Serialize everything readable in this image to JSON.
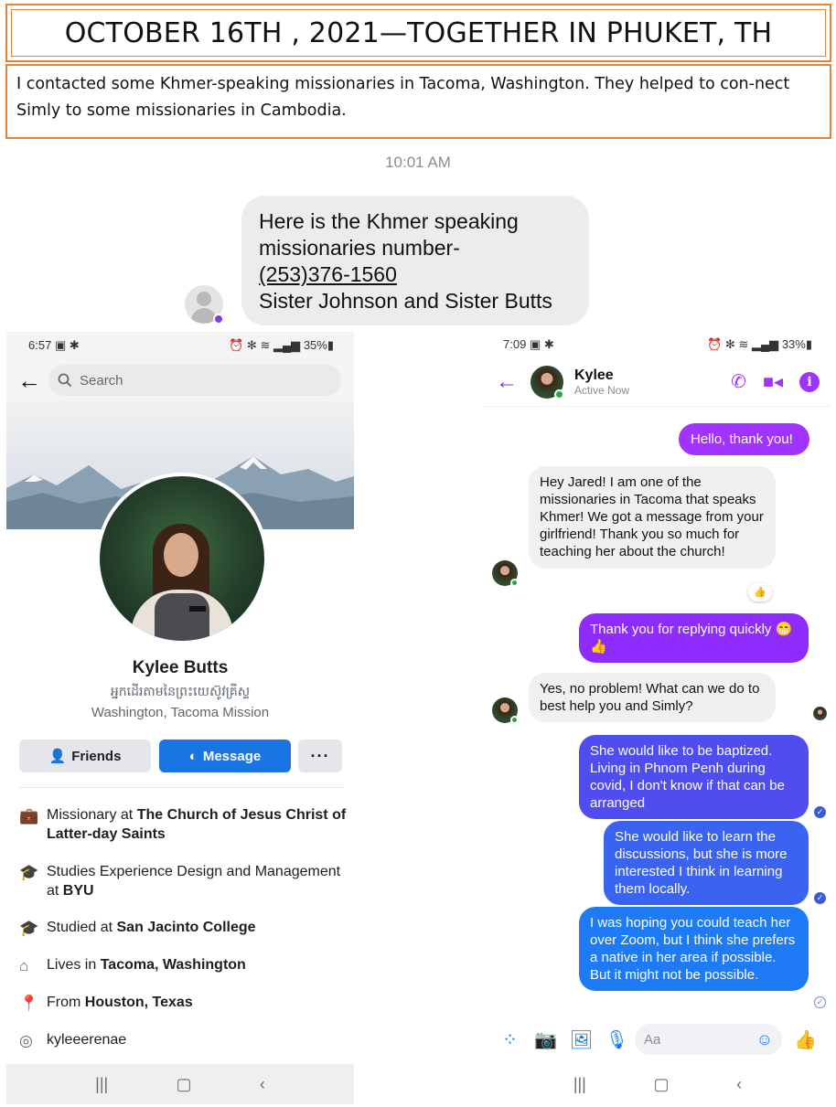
{
  "header": {
    "title": "OCTOBER 16TH , 2021—TOGETHER IN PHUKET, TH",
    "note": "I contacted some Khmer-speaking missionaries in Tacoma, Washington. They helped to con-nect Simly to some missionaries in Cambodia."
  },
  "sms": {
    "time": "10:01 AM",
    "line1": "Here is the Khmer speaking",
    "line2": "missionaries number-",
    "phone": "(253)376-1560",
    "line4": "Sister Johnson and Sister Butts"
  },
  "profile": {
    "status": {
      "time": "6:57",
      "battery": "35%"
    },
    "search_placeholder": "Search",
    "name": "Kylee Butts",
    "khmer": "អ្នកដើរតាមនៃព្រះយេស៊ូវគ្រីស្ទ",
    "mission": "Washington, Tacoma Mission",
    "buttons": {
      "friends": "Friends",
      "message": "Message",
      "more": "···"
    },
    "info": [
      {
        "icon": "briefcase-icon",
        "pre": "Missionary at ",
        "bold": "The Church of Jesus Christ of Latter-day Saints"
      },
      {
        "icon": "graduation-cap-icon",
        "pre": "Studies Experience Design and Management at ",
        "bold": "BYU"
      },
      {
        "icon": "graduation-cap-icon",
        "pre": "Studied at ",
        "bold": "San Jacinto College"
      },
      {
        "icon": "home-icon",
        "pre": "Lives in ",
        "bold": "Tacoma, Washington"
      },
      {
        "icon": "location-pin-icon",
        "pre": "From ",
        "bold": "Houston, Texas"
      },
      {
        "icon": "instagram-icon",
        "pre": "kyleeerenae",
        "bold": ""
      }
    ]
  },
  "messenger": {
    "status": {
      "time": "7:09",
      "battery": "33%"
    },
    "contact_name": "Kylee",
    "contact_status": "Active Now",
    "input_placeholder": "Aa",
    "messages": [
      {
        "dir": "out",
        "text": "Hello, thank you!",
        "color": "#a033ff"
      },
      {
        "dir": "in",
        "text": "Hey Jared! I am one of the missionaries in Tacoma that speaks Khmer! We got a message from your girlfriend! Thank you so much for teaching her about the church!",
        "reaction": "👍"
      },
      {
        "dir": "out",
        "text": "Thank you for replying quickly 😁👍",
        "color": "#8e2cff"
      },
      {
        "dir": "in",
        "text": "Yes, no problem! What can we do to best help you and Simly?"
      },
      {
        "dir": "out",
        "text": "She would like to be baptized. Living in Phnom Penh during covid, I don't know if that can be arranged",
        "color": "#4f4cf0"
      },
      {
        "dir": "out",
        "text": "She would like to learn the discussions, but she is more interested I think in learning them locally.",
        "color": "#3a63f2"
      },
      {
        "dir": "out",
        "text": "I was hoping you could teach her over Zoom, but I think she prefers a native in her area if possible. But it might not be possible.",
        "color": "#1e7bf5"
      }
    ]
  }
}
